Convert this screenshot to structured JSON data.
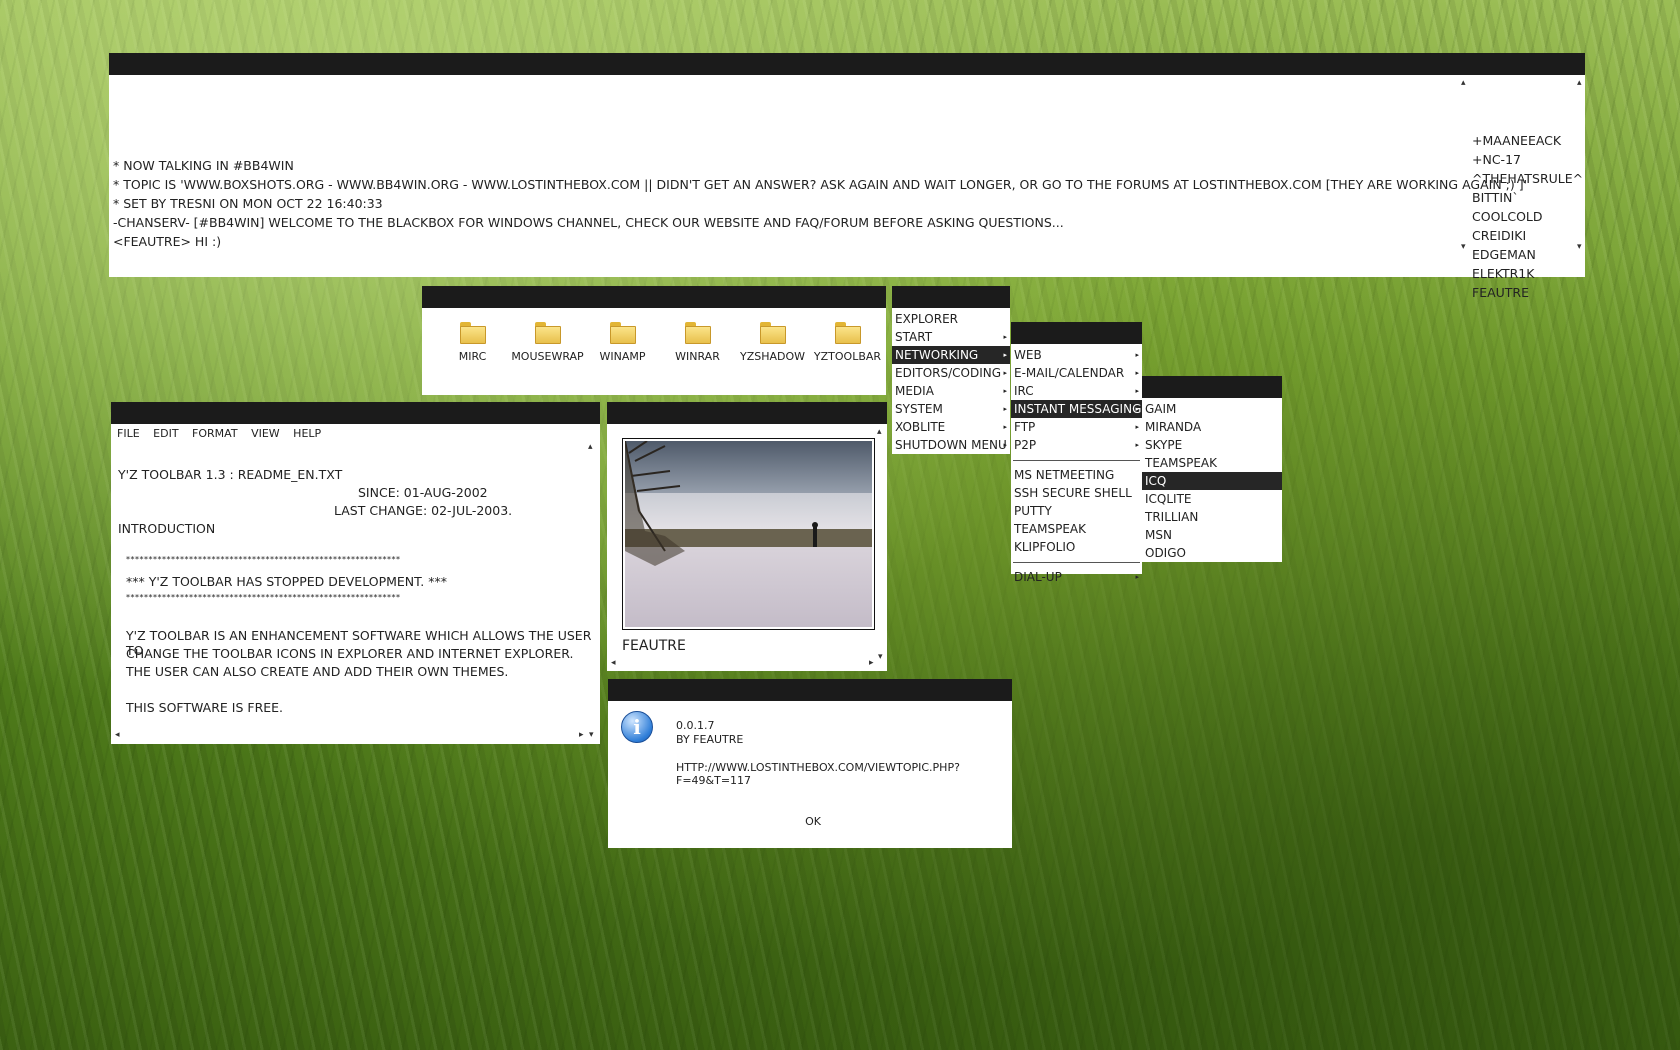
{
  "irc": {
    "messages": [
      "* NOW TALKING IN #BB4WIN",
      "* TOPIC IS 'WWW.BOXSHOTS.ORG - WWW.BB4WIN.ORG - WWW.LOSTINTHEBOX.COM || DIDN'T GET AN ANSWER?  ASK AGAIN AND WAIT LONGER, OR GO TO THE FORUMS AT LOSTINTHEBOX.COM [THEY ARE WORKING AGAIN ;) ]'",
      "* SET BY TRESNI ON MON OCT 22 16:40:33",
      "-CHANSERV- [#BB4WIN] WELCOME TO THE BLACKBOX FOR WINDOWS CHANNEL, CHECK OUR WEBSITE AND FAQ/FORUM BEFORE ASKING QUESTIONS...",
      "<FEAUTRE> HI :)"
    ],
    "nicks": [
      "+MAANEEACK",
      "+NC-17",
      "^THEHATSRULE^",
      "BITTIN`",
      "COOLCOLD",
      "CREIDIKI",
      "EDGEMAN",
      "ELEKTR1K",
      "FEAUTRE"
    ]
  },
  "folders": [
    "MIRC",
    "MOUSEWRAP",
    "WINAMP",
    "WINRAR",
    "YZSHADOW",
    "YZTOOLBAR"
  ],
  "menu_main": {
    "items": [
      {
        "label": "EXPLORER",
        "submenu": false
      },
      {
        "label": "START",
        "submenu": true
      },
      {
        "label": "NETWORKING",
        "submenu": true,
        "selected": true
      },
      {
        "label": "EDITORS/CODING",
        "submenu": true
      },
      {
        "label": "MEDIA",
        "submenu": true
      },
      {
        "label": "SYSTEM",
        "submenu": true
      },
      {
        "label": "XOBLITE",
        "submenu": true
      },
      {
        "label": "SHUTDOWN MENU",
        "submenu": true
      }
    ]
  },
  "menu_networking": {
    "items": [
      {
        "label": "WEB",
        "submenu": true
      },
      {
        "label": "E-MAIL/CALENDAR",
        "submenu": true
      },
      {
        "label": "IRC",
        "submenu": true
      },
      {
        "label": "INSTANT MESSAGING",
        "submenu": true,
        "selected": true
      },
      {
        "label": "FTP",
        "submenu": true
      },
      {
        "label": "P2P",
        "submenu": true
      },
      {
        "separator": true
      },
      {
        "label": "MS NETMEETING",
        "submenu": false
      },
      {
        "label": "SSH SECURE SHELL",
        "submenu": false
      },
      {
        "label": "PUTTY",
        "submenu": false
      },
      {
        "label": "TEAMSPEAK",
        "submenu": false
      },
      {
        "label": "KLIPFOLIO",
        "submenu": false
      },
      {
        "separator": true
      },
      {
        "label": "DIAL-UP",
        "submenu": true
      }
    ]
  },
  "menu_im": {
    "items": [
      {
        "label": "GAIM"
      },
      {
        "label": "MIRANDA"
      },
      {
        "label": "SKYPE"
      },
      {
        "label": "TEAMSPEAK"
      },
      {
        "label": "ICQ",
        "selected": true
      },
      {
        "label": "ICQLITE"
      },
      {
        "label": "TRILLIAN"
      },
      {
        "label": "MSN"
      },
      {
        "label": "ODIGO"
      }
    ]
  },
  "notepad": {
    "menus": [
      {
        "label": "FILE"
      },
      {
        "label": "EDIT"
      },
      {
        "label": "FORMAT"
      },
      {
        "label": "VIEW"
      },
      {
        "label": "HELP"
      }
    ],
    "title_line": "Y'Z TOOLBAR 1.3 : README_EN.TXT",
    "since": "SINCE: 01-AUG-2002",
    "last_change": "LAST CHANGE: 02-JUL-2003.",
    "intro": "INTRODUCTION",
    "stars": "*************************************************************",
    "stopped": "*** Y'Z TOOLBAR HAS STOPPED DEVELOPMENT. ***",
    "para1": "Y'Z TOOLBAR IS AN ENHANCEMENT SOFTWARE WHICH ALLOWS THE USER TO",
    "para2": "CHANGE THE TOOLBAR ICONS IN EXPLORER AND INTERNET EXPLORER.",
    "para3": "THE USER CAN ALSO CREATE AND ADD THEIR OWN THEMES.",
    "para4": "THIS SOFTWARE IS FREE."
  },
  "viewer": {
    "caption": "FEAUTRE"
  },
  "about": {
    "version": "0.0.1.7",
    "author": "BY FEAUTRE",
    "url": "HTTP://WWW.LOSTINTHEBOX.COM/VIEWTOPIC.PHP?F=49&T=117",
    "ok_label": "OK"
  }
}
